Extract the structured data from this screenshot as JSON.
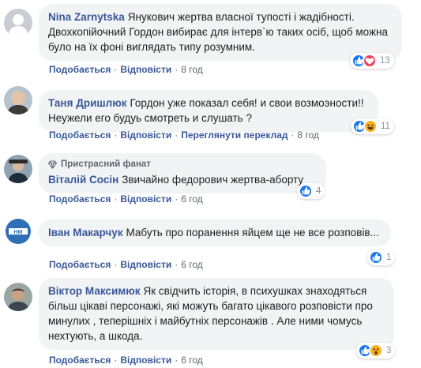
{
  "colors": {
    "link": "#385898",
    "bubble": "#f2f3f5",
    "like_blue": "#1877f2",
    "love_red": "#f33e58",
    "haha_yellow": "#f7b125",
    "meta": "#606770"
  },
  "labels": {
    "like": "Подобається",
    "reply": "Відповісти",
    "separator": "·",
    "see_translation": "Переглянути переклад"
  },
  "comments": [
    {
      "author": "Nina Zarnytska",
      "text": "Янукович жертва власної тупості і жадібності. Двохкопійочний Гордон вибирає для інтерв`ю таких осіб, щоб можна було на їх фоні виглядать типу розумним.",
      "time": "8 год",
      "reactions": [
        "like-icon",
        "love-icon"
      ],
      "reaction_count": "13"
    },
    {
      "author": "Таня Дришлюк",
      "text": "Гордон уже показал себя! и свои возмоэности!! Неужели его будуь смотреть и слушать ?",
      "time": "8 год",
      "reactions": [
        "like-icon",
        "haha-icon"
      ],
      "reaction_count": "11"
    },
    {
      "badge": "Пристрасний фанат",
      "author": "Віталій Сосін",
      "text": "Звичайно федорович жертва-аборту",
      "time": "6 год",
      "reactions": [
        "like-icon"
      ],
      "reaction_count": "4"
    },
    {
      "author": "Іван Макарчук",
      "text": "Мабуть про поранення яйцем ще не все розповів...",
      "time": "6 год",
      "reactions": [
        "like-icon"
      ],
      "reaction_count": "1"
    },
    {
      "author": "Віктор Максимюк",
      "text": "Як свідчить історія, в психушках знаходяться більш цікаві персонажі, які можуть багато цікавого розповісти про минулих , теперішніх і майбутніх персонажів . Але ними чомусь нехтують, а шкода.",
      "time": "6 год",
      "reactions": [
        "like-icon",
        "wow-icon"
      ],
      "reaction_count": "3"
    }
  ]
}
